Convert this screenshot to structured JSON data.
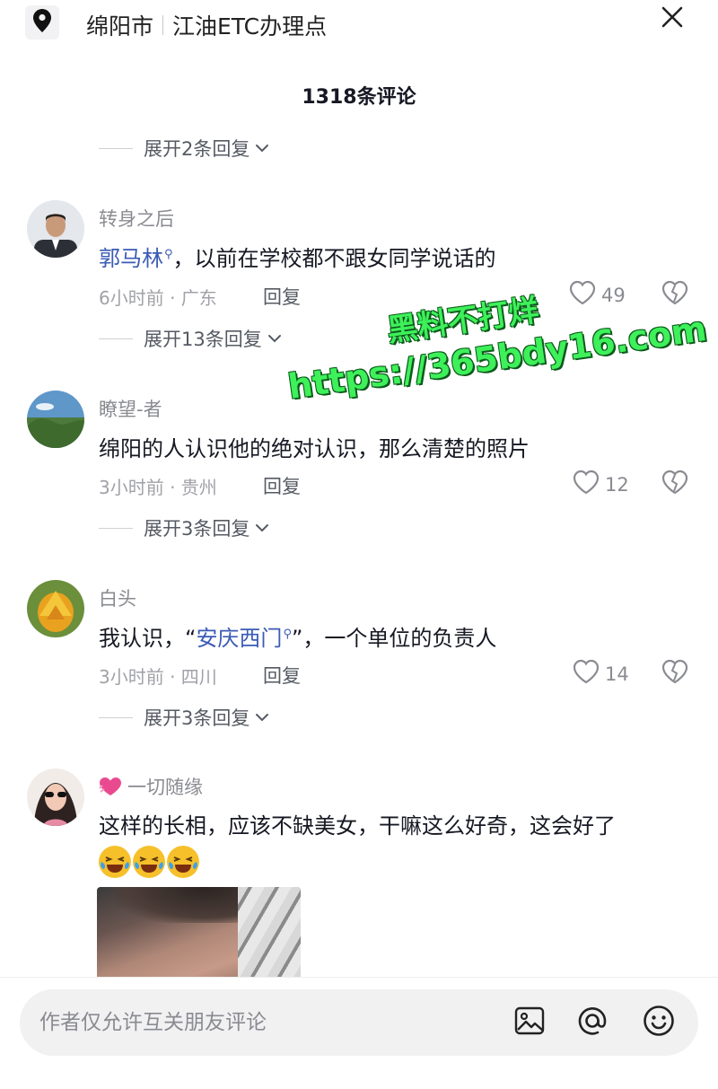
{
  "header": {
    "city": "绵阳市",
    "place": "江油ETC办理点"
  },
  "comments_count_label": "1318条评论",
  "expand_top": "展开2条回复",
  "comments": [
    {
      "username": "转身之后",
      "mention": "郭马林",
      "text_after": "，以前在学校都不跟女同学说话的",
      "meta": "6小时前 · 广东",
      "reply": "回复",
      "likes": "49",
      "expand": "展开13条回复"
    },
    {
      "username": "瞭望-者",
      "text": "绵阳的人认识他的绝对认识，那么清楚的照片",
      "meta": "3小时前 · 贵州",
      "reply": "回复",
      "likes": "12",
      "expand": "展开3条回复"
    },
    {
      "username": "白头",
      "text_before": "我认识，“",
      "mention": "安庆西门",
      "text_after": "”，一个单位的负责人",
      "meta": "3小时前 · 四川",
      "reply": "回复",
      "likes": "14",
      "expand": "展开3条回复"
    },
    {
      "username": "一切随缘",
      "text": "这样的长相，应该不缺美女，干嘛这么好奇，这会好了",
      "emoji": [
        "laughing-crying-emoji",
        "laughing-crying-emoji",
        "laughing-crying-emoji"
      ]
    }
  ],
  "watermark": {
    "line1": "黑料不打烊",
    "line2": "https://365bdy16.com"
  },
  "input": {
    "placeholder": "作者仅允许互关朋友评论"
  },
  "colors": {
    "mention": "#3b5bb5",
    "watermark": "#3ef05a",
    "emoji": "#f6c02a"
  }
}
